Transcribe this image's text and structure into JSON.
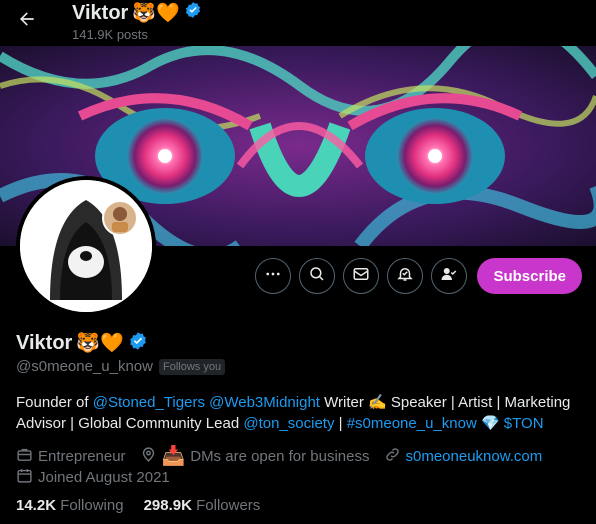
{
  "header": {
    "title": "Viktor",
    "title_emojis": "🐯🧡",
    "posts_count": "141.9K posts"
  },
  "profile": {
    "name": "Viktor",
    "name_emojis": "🐯🧡",
    "handle": "@s0meone_u_know",
    "follows_you": "Follows you",
    "bio": {
      "p1": "Founder of ",
      "link1": "@Stoned_Tigers",
      "p2": " ",
      "link2": "@Web3Midnight",
      "p3": " Writer ✍️ Speaker | Artist | Marketing Advisor | Global Community Lead ",
      "link3": "@ton_society",
      "p4": " | ",
      "link4": "#s0meone_u_know",
      "p5": " 💎 ",
      "link5": "$TON"
    },
    "category": "Entrepreneur",
    "location_prefix": "📥",
    "location": "DMs are open for business",
    "website": "s0meoneuknow.com",
    "joined": "Joined August 2021",
    "following_count": "14.2K",
    "following_label": "Following",
    "followers_count": "298.9K",
    "followers_label": "Followers"
  },
  "actions": {
    "subscribe_label": "Subscribe"
  },
  "colors": {
    "accent_link": "#1d9bf0",
    "subscribe_bg": "#c936cc",
    "verified": "#1d9bf0"
  }
}
